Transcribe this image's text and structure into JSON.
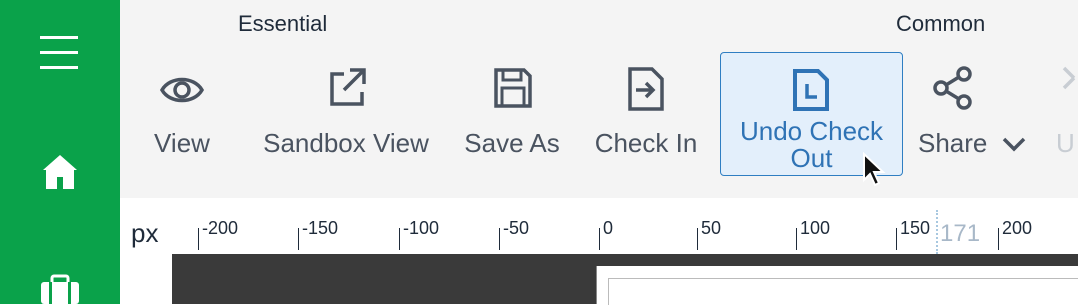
{
  "toolbar": {
    "groups": {
      "essential": "Essential",
      "common": "Common"
    },
    "buttons": {
      "view": "View",
      "sandbox_view": "Sandbox View",
      "save_as": "Save As",
      "check_in": "Check In",
      "undo_check_out": "Undo Check Out",
      "share": "Share",
      "clipped": "U"
    }
  },
  "ruler": {
    "unit": "px",
    "ticks": [
      "-200",
      "-150",
      "-100",
      "-50",
      "0",
      "50",
      "100",
      "150",
      "200"
    ],
    "marker": "171"
  },
  "colors": {
    "sidebar": "#0aa24a",
    "accent": "#2f7ec2",
    "active_bg": "#e3effb"
  },
  "icons": {
    "sidebar": [
      "hamburger-menu-icon",
      "home-icon",
      "briefcase-icon"
    ],
    "toolbar": [
      "eye-icon",
      "external-link-icon",
      "floppy-disk-icon",
      "document-arrow-in-icon",
      "document-clock-icon",
      "share-nodes-icon",
      "chevron-down-icon"
    ]
  }
}
